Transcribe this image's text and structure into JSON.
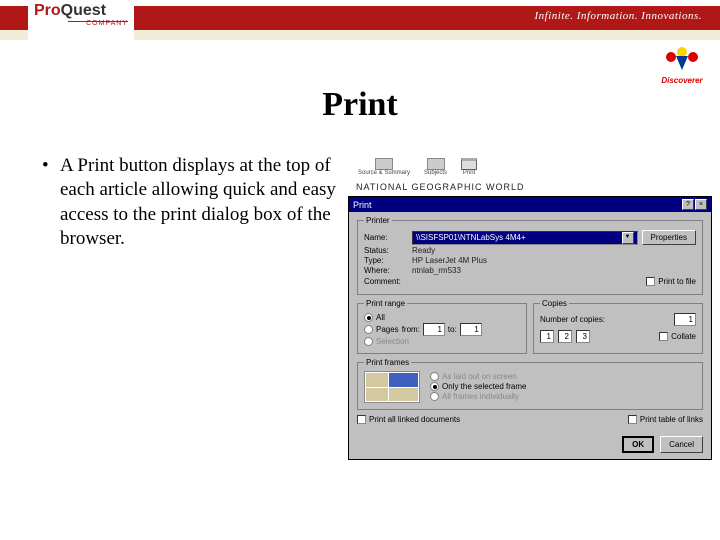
{
  "header": {
    "logo_pro": "Pro",
    "logo_quest": "Quest",
    "logo_company": "COMPANY",
    "tagline": "Infinite. Information. Innovations.",
    "discoverer_label": "Discoverer"
  },
  "slide": {
    "title": "Print",
    "bullet1": "A Print button displays at the top of each article allowing quick and easy access to the print dialog box of the browser."
  },
  "toolbar": {
    "source_summary": "Source & Summary",
    "subjects": "Subjects",
    "print": "Print"
  },
  "article": {
    "title": "NATIONAL GEOGRAPHIC WORLD"
  },
  "dialog": {
    "title": "Print",
    "help_btn": "?",
    "close_btn": "×",
    "printer_legend": "Printer",
    "name_label": "Name:",
    "name_value": "\\\\SISFSP01\\NTNLabSys 4M4+",
    "properties_btn": "Properties",
    "status_label": "Status:",
    "status_value": "Ready",
    "type_label": "Type:",
    "type_value": "HP LaserJet 4M Plus",
    "where_label": "Where:",
    "where_value": "ntnlab_rm533",
    "comment_label": "Comment:",
    "print_to_file": "Print to file",
    "range_legend": "Print range",
    "range_all": "All",
    "range_pages": "Pages",
    "range_from": "from:",
    "range_from_val": "1",
    "range_to": "to:",
    "range_to_val": "1",
    "range_selection": "Selection",
    "copies_legend": "Copies",
    "copies_label": "Number of copies:",
    "copies_value": "1",
    "collate": "Collate",
    "frames_legend": "Print frames",
    "frames_opt1": "As laid out on screen",
    "frames_opt2": "Only the selected frame",
    "frames_opt3": "All frames individually",
    "linked_docs": "Print all linked documents",
    "table_links": "Print table of links",
    "ok_btn": "OK",
    "cancel_btn": "Cancel"
  },
  "colors": {
    "brand_red": "#b01818",
    "win_blue": "#000080",
    "win_gray": "#c0c0c0"
  }
}
